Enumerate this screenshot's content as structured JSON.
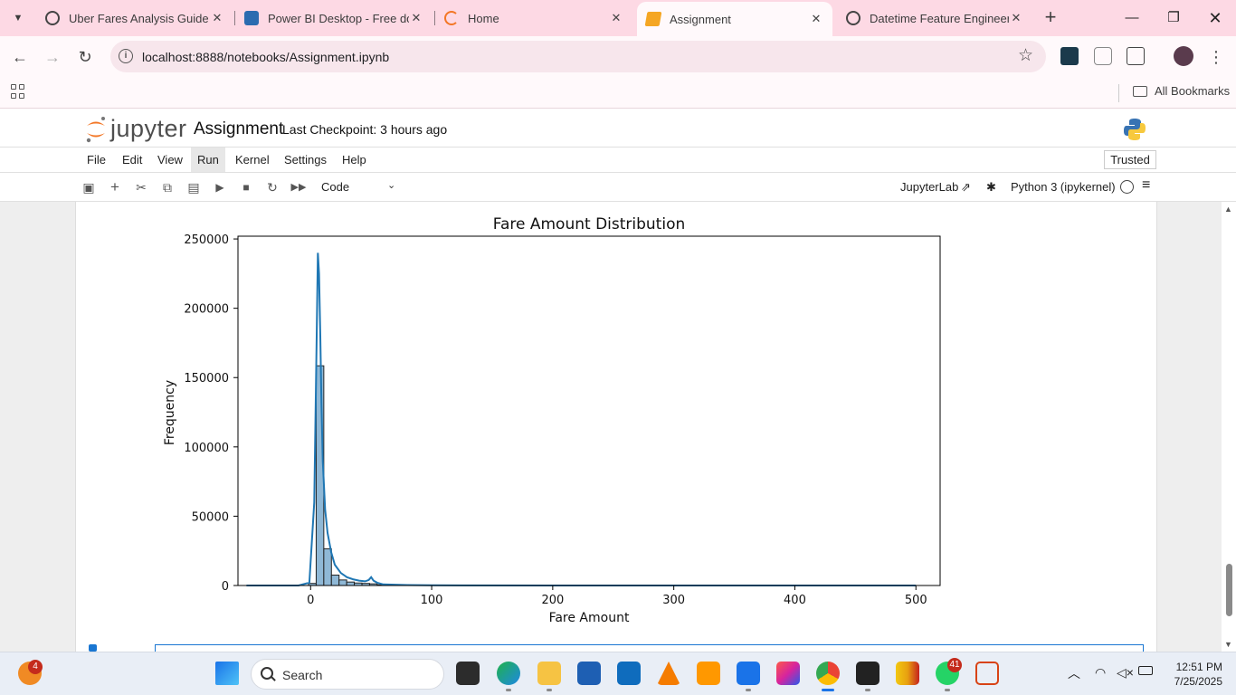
{
  "browser": {
    "tabs": [
      {
        "title": "Uber Fares Analysis Guide",
        "active": false
      },
      {
        "title": "Power BI Desktop - Free dow",
        "active": false
      },
      {
        "title": "Home",
        "active": false
      },
      {
        "title": "Assignment",
        "active": true
      },
      {
        "title": "Datetime Feature Engineerin",
        "active": false
      }
    ],
    "url": "localhost:8888/notebooks/Assignment.ipynb",
    "bookmarks_label": "All Bookmarks"
  },
  "jupyter": {
    "brand": "jupyter",
    "notebook_title": "Assignment",
    "checkpoint": "Last Checkpoint: 3 hours ago",
    "menu": [
      "File",
      "Edit",
      "View",
      "Run",
      "Kernel",
      "Settings",
      "Help"
    ],
    "trusted_label": "Trusted",
    "cell_type": "Code",
    "jupyterlab_label": "JupyterLab",
    "kernel_label": "Python 3 (ipykernel)"
  },
  "chart_data": {
    "type": "bar",
    "title": "Fare Amount Distribution",
    "xlabel": "Fare Amount",
    "ylabel": "Frequency",
    "xlim": [
      -60,
      520
    ],
    "ylim": [
      0,
      252000
    ],
    "x_ticks": [
      0,
      100,
      200,
      300,
      400,
      500
    ],
    "y_ticks": [
      0,
      50000,
      100000,
      150000,
      200000,
      250000
    ],
    "bin_edges": [
      -1.7,
      4.6,
      10.9,
      17.2,
      23.5,
      29.8,
      36.1,
      42.4,
      48.7,
      55.0,
      61.3
    ],
    "values": [
      1500,
      158500,
      26500,
      7500,
      4000,
      2500,
      1800,
      1500,
      1200,
      500
    ],
    "kde_x": [
      -53,
      -10,
      -1,
      3,
      5,
      6,
      7,
      8,
      9,
      10,
      12,
      14,
      17,
      20,
      25,
      30,
      35,
      40,
      45,
      48,
      50,
      52,
      55,
      60,
      80,
      100,
      200,
      300,
      400,
      500
    ],
    "kde_y": [
      0,
      0,
      2000,
      60000,
      180000,
      240000,
      225000,
      180000,
      130000,
      90000,
      55000,
      38000,
      24000,
      15000,
      9000,
      6000,
      4500,
      3500,
      3000,
      4000,
      6000,
      3500,
      2000,
      800,
      300,
      100,
      0,
      0,
      0,
      0
    ],
    "bar_color": "#8fb8d6",
    "kde_color": "#1f77b4"
  },
  "taskbar": {
    "search_label": "Search",
    "time": "12:51 PM",
    "date": "7/25/2025",
    "badge_left": "4",
    "badge_whatsapp": "41"
  }
}
